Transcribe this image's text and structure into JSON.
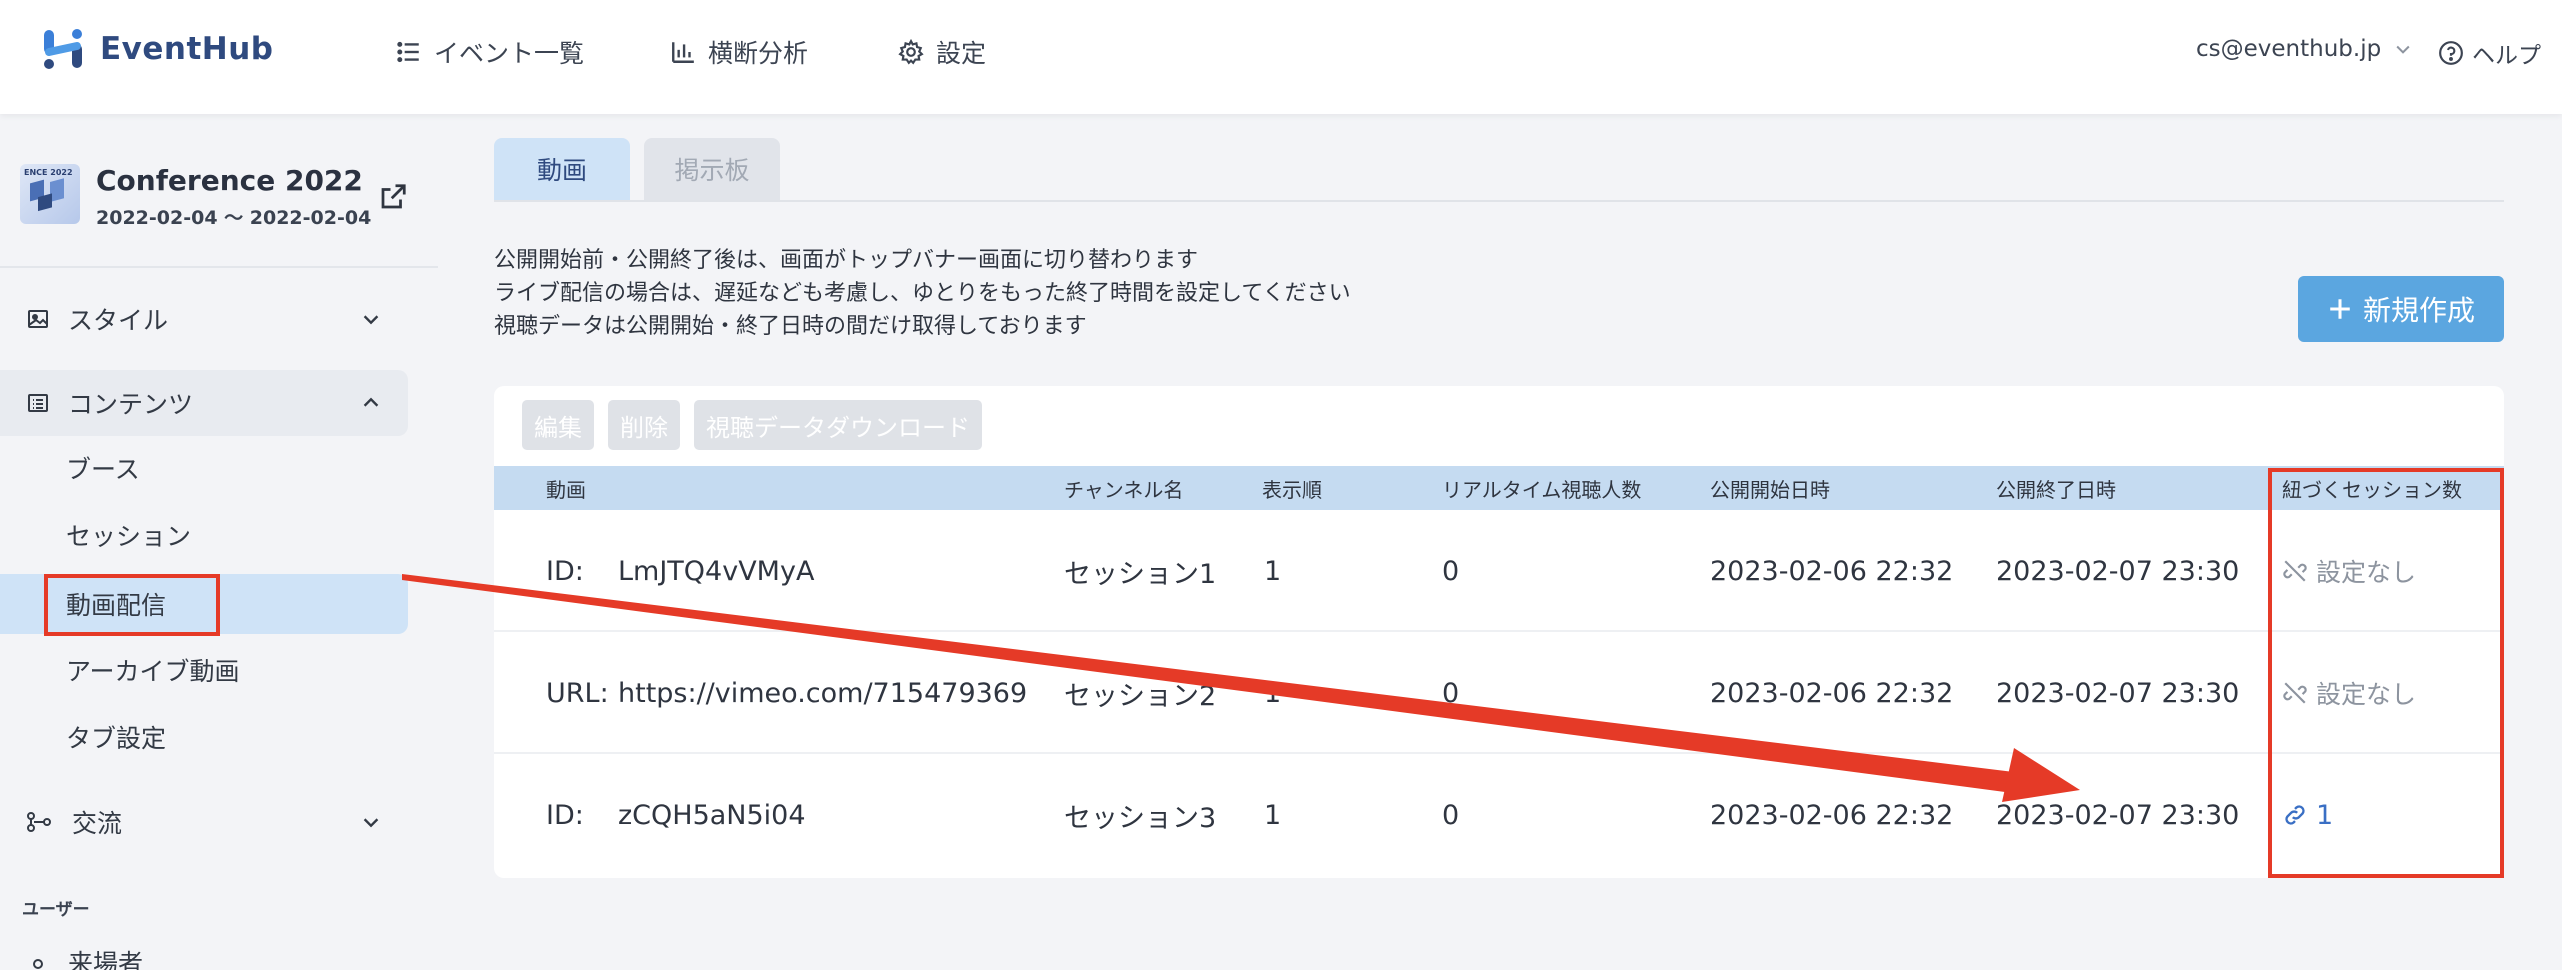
{
  "header": {
    "brand": "EventHub",
    "nav": [
      {
        "label": "イベント一覧"
      },
      {
        "label": "横断分析"
      },
      {
        "label": "設定"
      }
    ],
    "user_email": "cs@eventhub.jp",
    "help_label": "ヘルプ"
  },
  "sidebar": {
    "event_thumb_text": "ENCE 2022",
    "event_name": "Conference 2022",
    "event_date": "2022-02-04 〜 2022-02-04",
    "groups": [
      {
        "label": "スタイル",
        "icon": "image-icon"
      },
      {
        "label": "コンテンツ",
        "icon": "list-icon"
      },
      {
        "label": "交流",
        "icon": "network-icon"
      }
    ],
    "content_items": [
      {
        "label": "ブース"
      },
      {
        "label": "セッション"
      },
      {
        "label": "動画配信"
      },
      {
        "label": "アーカイブ動画"
      },
      {
        "label": "タブ設定"
      }
    ],
    "section_label": "ユーザー",
    "partial_item": "来場者"
  },
  "main": {
    "tabs": [
      {
        "label": "動画"
      },
      {
        "label": "掲示板"
      }
    ],
    "notes": [
      "公開開始前・公開終了後は、画面がトップバナー画面に切り替わります",
      "ライブ配信の場合は、遅延なども考慮し、ゆとりをもった終了時間を設定してください",
      "視聴データは公開開始・終了日時の間だけ取得しております"
    ],
    "create_button": "新規作成",
    "toolbar": {
      "edit": "編集",
      "delete": "削除",
      "download": "視聴データダウンロード"
    },
    "table": {
      "columns": [
        "動画",
        "チャンネル名",
        "表示順",
        "リアルタイム視聴人数",
        "公開開始日時",
        "公開終了日時",
        "紐づくセッション数"
      ],
      "rows": [
        {
          "video_prefix": "ID:",
          "video_value": "LmJTQ4vVMyA",
          "channel": "セッション1",
          "order": "1",
          "viewers": "0",
          "start": "2023-02-06 22:32",
          "end": "2023-02-07 23:30",
          "sessions": "設定なし",
          "linked": false
        },
        {
          "video_prefix": "URL:",
          "video_value": "https://vimeo.com/715479369",
          "channel": "セッション2",
          "order": "1",
          "viewers": "0",
          "start": "2023-02-06 22:32",
          "end": "2023-02-07 23:30",
          "sessions": "設定なし",
          "linked": false
        },
        {
          "video_prefix": "ID:",
          "video_value": "zCQH5aN5i04",
          "channel": "セッション3",
          "order": "1",
          "viewers": "0",
          "start": "2023-02-06 22:32",
          "end": "2023-02-07 23:30",
          "sessions": "1",
          "linked": true
        }
      ]
    }
  },
  "colors": {
    "accent": "#5ba6e0",
    "tab_active_bg": "#cfe3f7",
    "table_header_bg": "#c5dbf1",
    "annotation_red": "#e53a27",
    "link_blue": "#3a6fc4"
  }
}
